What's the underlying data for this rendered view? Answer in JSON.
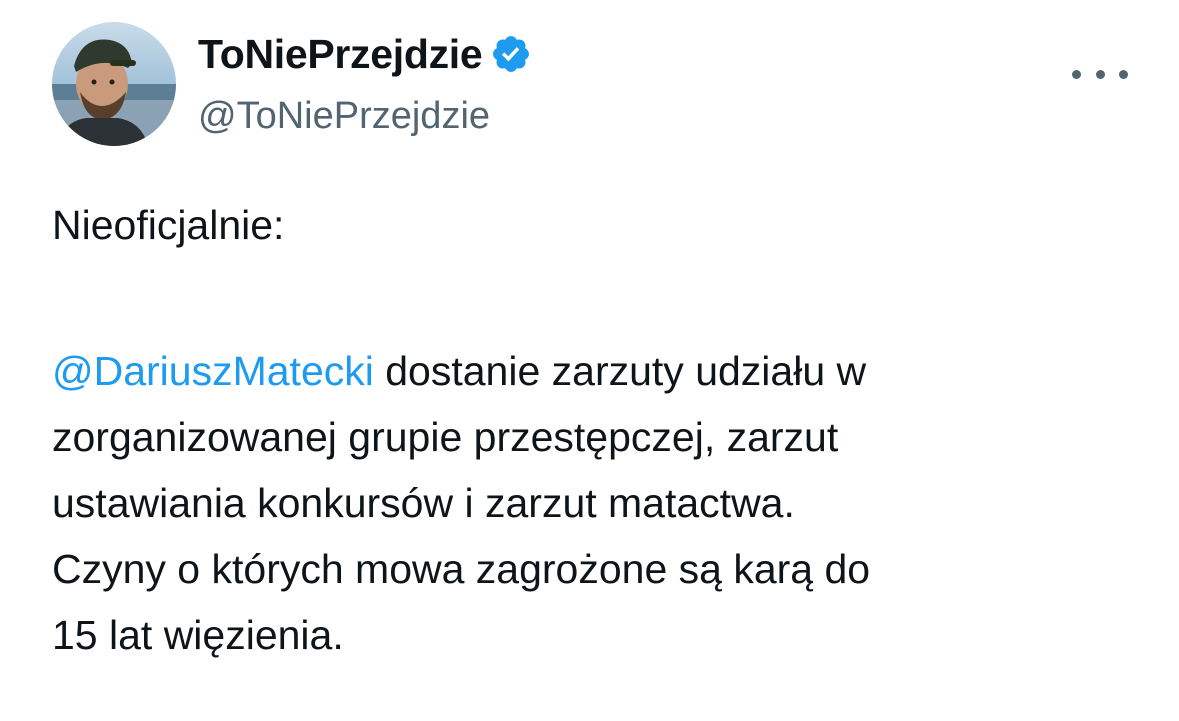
{
  "tweet": {
    "author": {
      "display_name": "ToNiePrzejdzie",
      "handle": "@ToNiePrzejdzie",
      "verified": true,
      "avatar_icon": "profile-photo-icon"
    },
    "intro_text": "Nieoficjalnie:",
    "mention": "@DariuszMatecki",
    "lines": [
      " dostanie zarzuty udziału w",
      "zorganizowanej grupie przestępczej, zarzut",
      "ustawiania konkursów i zarzut matactwa.",
      "Czyny o których mowa zagrożone są karą do",
      "15 lat więzienia."
    ],
    "more_icon": "more-dots-icon"
  },
  "colors": {
    "text": "#0f1419",
    "secondary_text": "#536471",
    "accent": "#1d9bf0"
  }
}
